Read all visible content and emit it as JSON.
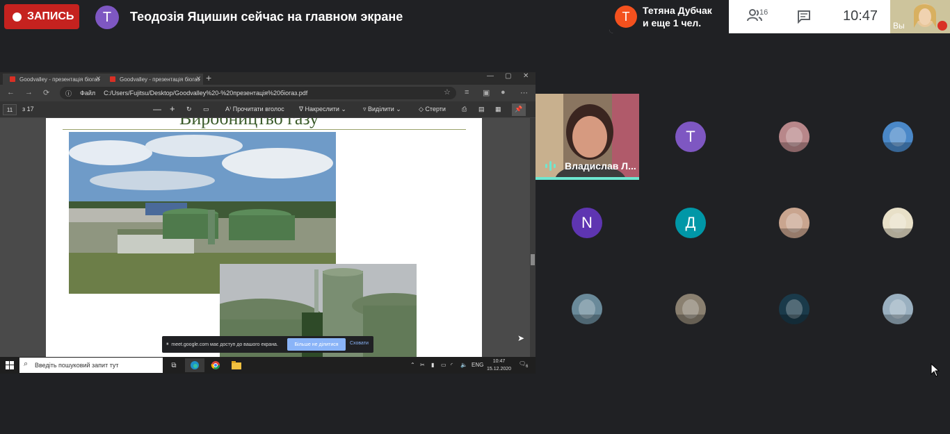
{
  "topbar": {
    "record_label": "ЗАПИСЬ",
    "presenter_initial": "T",
    "presenter_text": "Теодозія Яцишин сейчас на главном экране",
    "speaker_initial": "T",
    "speaker_line1": "Тетяна Дубчак",
    "speaker_line2": "и еще 1 чел.",
    "people_count": "16",
    "time": "10:47",
    "self_label": "Вы",
    "colors": {
      "record": "#c5221f",
      "presenter_avatar": "#7e57c2",
      "speaker_avatar": "#f4511e"
    }
  },
  "browser": {
    "tabs": [
      {
        "label": "Goodvalley - презентація біогаз"
      },
      {
        "label": "Goodvalley - презентація біогаз"
      }
    ],
    "new_tab": "+",
    "url_scheme_label": "Файл",
    "url": "C:/Users/Fujitsu/Desktop/Goodvalley%20-%20презентація%20біогаз.pdf",
    "window_controls": [
      "—",
      "▢",
      "✕"
    ]
  },
  "pdf_toolbar": {
    "page_number": "11",
    "page_total": "з 17",
    "zoom_out": "—",
    "zoom_in": "+",
    "read_aloud": "Прочитати вголос",
    "draw": "Накреслити",
    "highlight": "Виділити",
    "erase": "Стерти"
  },
  "pdf_page": {
    "title": "Виробництво газу"
  },
  "share_notice": {
    "text": "meet.google.com має доступ до вашого екрана.",
    "stop_label": "Більше не ділитися",
    "hide_label": "Сховати"
  },
  "taskbar": {
    "search_placeholder": "Введіть пошуковий запит тут",
    "lang": "ENG",
    "time": "10:47",
    "date": "15.12.2020",
    "notif_count": "6"
  },
  "participants": {
    "active_name": "Владислав Л...",
    "tiles": [
      {
        "type": "letter",
        "letter": "T",
        "color": "#7e57c2"
      },
      {
        "type": "photo",
        "icon": "person-photo-icon",
        "color": "#b8878a"
      },
      {
        "type": "photo",
        "icon": "person-photo-icon",
        "color": "#4a88c8"
      },
      {
        "type": "letter",
        "letter": "N",
        "color": "#5e35b1"
      },
      {
        "type": "letter",
        "letter": "Д",
        "color": "#0097a7"
      },
      {
        "type": "photo",
        "icon": "person-photo-icon",
        "color": "#c9a58f"
      },
      {
        "type": "photo",
        "icon": "badge-photo-icon",
        "color": "#e8e0c8"
      },
      {
        "type": "photo",
        "icon": "landscape-photo-icon",
        "color": "#6a8a9a"
      },
      {
        "type": "photo",
        "icon": "landscape-photo-icon",
        "color": "#8a8070"
      },
      {
        "type": "photo",
        "icon": "logo-photo-icon",
        "color": "#1a3a4a"
      },
      {
        "type": "photo",
        "icon": "landscape-photo-icon",
        "color": "#9ab0c0"
      }
    ]
  }
}
